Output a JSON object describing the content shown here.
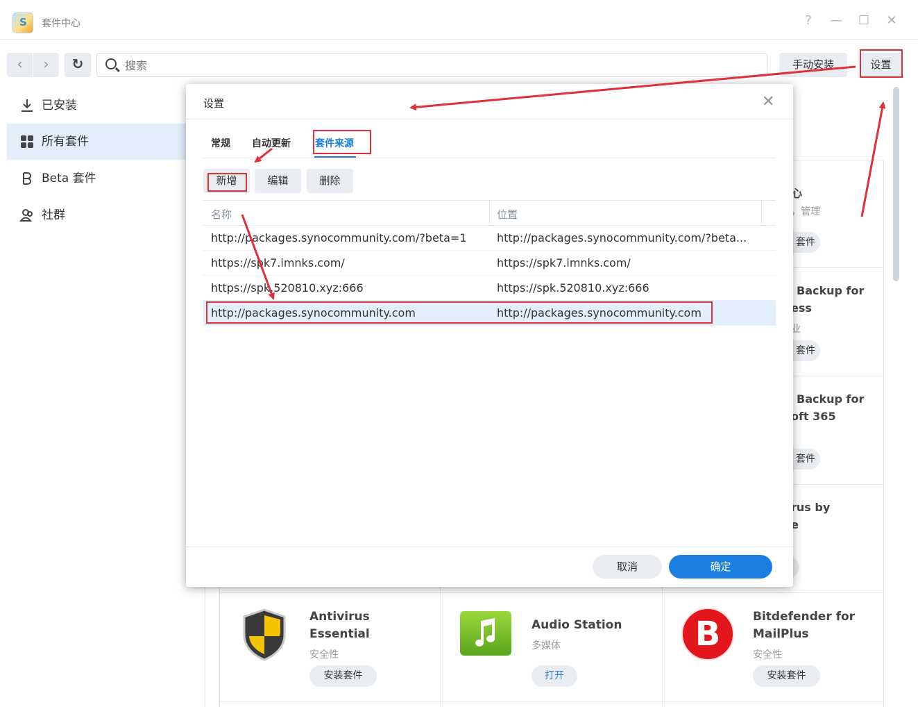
{
  "window": {
    "title": "套件中心",
    "app_icon_letter": "S",
    "help": "?",
    "minimize": "—",
    "maximize": "☐",
    "close": "✕"
  },
  "toolbar": {
    "back": "‹",
    "forward": "›",
    "refresh": "↻",
    "search_placeholder": "搜索",
    "manual_install": "手动安装",
    "settings": "设置"
  },
  "sidebar": {
    "items": [
      {
        "label": "已安装",
        "icon": "download-icon"
      },
      {
        "label": "所有套件",
        "icon": "grid-icon"
      },
      {
        "label": "Beta 套件",
        "icon": "beta-icon"
      },
      {
        "label": "社群",
        "icon": "community-icon"
      }
    ]
  },
  "background_cards": {
    "partial": [
      {
        "line1": "心",
        "line2": "，管理",
        "button": "套件"
      },
      {
        "line1": "Backup for",
        "line2": "ess",
        "sub": "业",
        "button": "套件"
      },
      {
        "line1": "Backup for",
        "line2": "oft 365",
        "button": "套件"
      },
      {
        "line1": "rus by",
        "line2": "e"
      }
    ],
    "packages": [
      {
        "name1": "Antivirus",
        "name2": "Essential",
        "category": "安全性",
        "button": "安装套件",
        "icon": "shield-icon"
      },
      {
        "name1": "Audio Station",
        "category": "多媒体",
        "button": "打开",
        "icon": "music-note-icon"
      },
      {
        "name1": "Bitdefender for",
        "name2": "MailPlus",
        "category": "安全性",
        "button": "安装套件",
        "icon": "bitdefender-logo-icon",
        "logo_letter": "B"
      }
    ]
  },
  "dialog": {
    "title": "设置",
    "close": "✕",
    "tabs": [
      "常规",
      "自动更新",
      "套件来源"
    ],
    "actions": {
      "add": "新增",
      "edit": "编辑",
      "delete": "删除"
    },
    "columns": {
      "name": "名称",
      "location": "位置"
    },
    "rows": [
      {
        "name": "http://packages.synocommunity.com/?beta=1",
        "location": "http://packages.synocommunity.com/?beta..."
      },
      {
        "name": "https://spk7.imnks.com/",
        "location": "https://spk7.imnks.com/"
      },
      {
        "name": "https://spk.520810.xyz:666",
        "location": "https://spk.520810.xyz:666"
      },
      {
        "name": "http://packages.synocommunity.com",
        "location": "http://packages.synocommunity.com"
      }
    ],
    "cancel": "取消",
    "ok": "确定"
  },
  "colors": {
    "accent": "#1a7fe0",
    "annotation_red": "#e0303a",
    "selected_row": "#e3eefb",
    "button_gray": "#e9ecf0"
  }
}
